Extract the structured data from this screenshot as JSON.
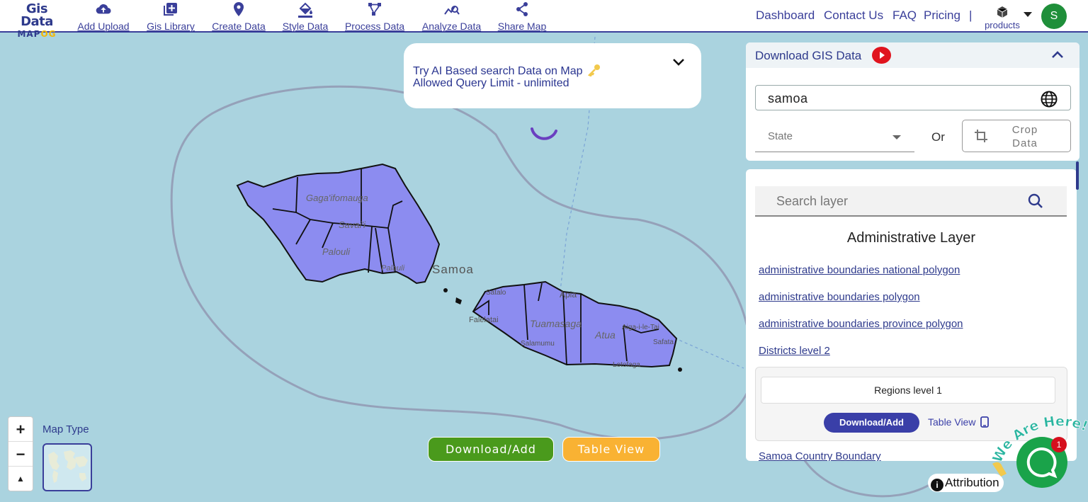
{
  "logo": {
    "line1": "Gis Data",
    "line2_a": "MAP",
    "line2_b": "OG"
  },
  "nav": [
    {
      "label": "Add Upload",
      "icon": "cloud-upload-icon"
    },
    {
      "label": "Gis Library",
      "icon": "library-add-icon"
    },
    {
      "label": "Create Data",
      "icon": "location-pin-icon"
    },
    {
      "label": "Style Data",
      "icon": "paint-bucket-icon"
    },
    {
      "label": "Process Data",
      "icon": "process-nodes-icon"
    },
    {
      "label": "Analyze Data",
      "icon": "analyze-chart-icon"
    },
    {
      "label": "Share Map",
      "icon": "share-icon"
    }
  ],
  "right_nav": {
    "dashboard": "Dashboard",
    "contact": "Contact Us",
    "faq": "FAQ",
    "pricing": "Pricing",
    "sep": "|",
    "products": "products"
  },
  "user": {
    "initial": "S",
    "avatar_color": "#1f8f3a"
  },
  "ai_search": {
    "line1": "Try AI Based search Data on Map",
    "line2": "Allowed Query Limit - unlimited"
  },
  "map": {
    "country_label": "Samoa",
    "place_labels": [
      "Gaga'ifomauga",
      "Savai'i",
      "Palouli",
      "Palauli",
      "Falelatai",
      "Tuamasaga",
      "Atua",
      "Apia",
      "Aiga-i-le-Tai",
      "Lotofaga",
      "Satalo",
      "Salamumu",
      "Safata"
    ],
    "polygon_color": "#8c8cf0",
    "download_btn": "Download/Add",
    "table_btn": "Table View",
    "map_type_label": "Map Type",
    "attribution": "Attribution",
    "chat_badge": "1",
    "we_are_here": "We Are Here!"
  },
  "download_panel": {
    "title": "Download GIS Data",
    "country_value": "samoa",
    "state_placeholder": "State",
    "or_text": "Or",
    "crop_label": "Crop Data"
  },
  "layer_panel": {
    "search_placeholder": "Search layer",
    "section_title": "Administrative Layer",
    "links": [
      "administrative boundaries national polygon",
      "administrative boundaries polygon",
      "administrative boundaries province polygon",
      "Districts level 2"
    ],
    "selected_layer": "Regions level 1",
    "selected_download": "Download/Add",
    "selected_table": "Table View",
    "next_link": "Samoa Country Boundary"
  },
  "colors": {
    "accent": "#3a3f9a",
    "green": "#4a9a1c",
    "orange": "#f9b233",
    "ocean": "#aad3df"
  }
}
